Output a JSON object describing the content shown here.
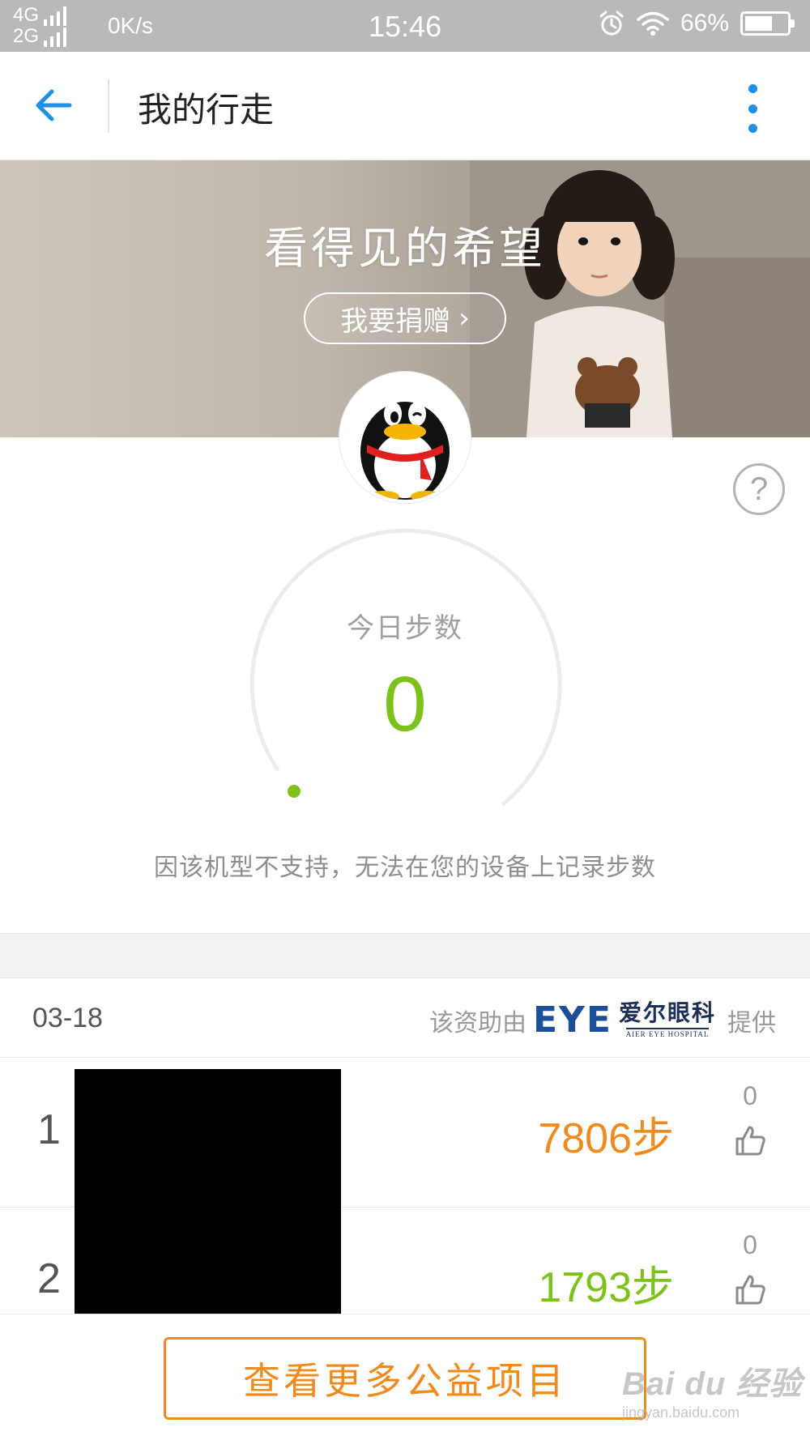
{
  "status_bar": {
    "network_1": "4G",
    "network_2": "2G",
    "speed": "0K/s",
    "time": "15:46",
    "battery": "66%",
    "battery_level": 0.66
  },
  "header": {
    "back_icon": "arrow-left-icon",
    "title": "我的行走",
    "more_icon": "more-vertical-icon"
  },
  "banner": {
    "title": "看得见的希望",
    "donate_label": "我要捐赠",
    "donate_chevron": "›"
  },
  "help": {
    "label": "?"
  },
  "steps": {
    "label": "今日步数",
    "value": "0",
    "notice": "因该机型不支持，无法在您的设备上记录步数"
  },
  "sponsor": {
    "date": "03-18",
    "prefix": "该资助由",
    "logo_text": "EYE",
    "brand_cn": "爱尔眼科",
    "brand_en": "AIER EYE HOSPITAL",
    "suffix": "提供"
  },
  "ranking": [
    {
      "rank": "1",
      "steps": "7806步",
      "likes": "0",
      "color": "#f08a1d"
    },
    {
      "rank": "2",
      "steps": "1793步",
      "likes": "0",
      "color": "#7dc21b"
    }
  ],
  "footer": {
    "more_projects_label": "查看更多公益项目"
  },
  "watermark": {
    "main": "Bai du 经验",
    "sub": "jingyan.baidu.com"
  },
  "colors": {
    "accent_blue": "#1e8fe6",
    "step_green": "#7dc21b",
    "orange": "#f08a1d"
  }
}
